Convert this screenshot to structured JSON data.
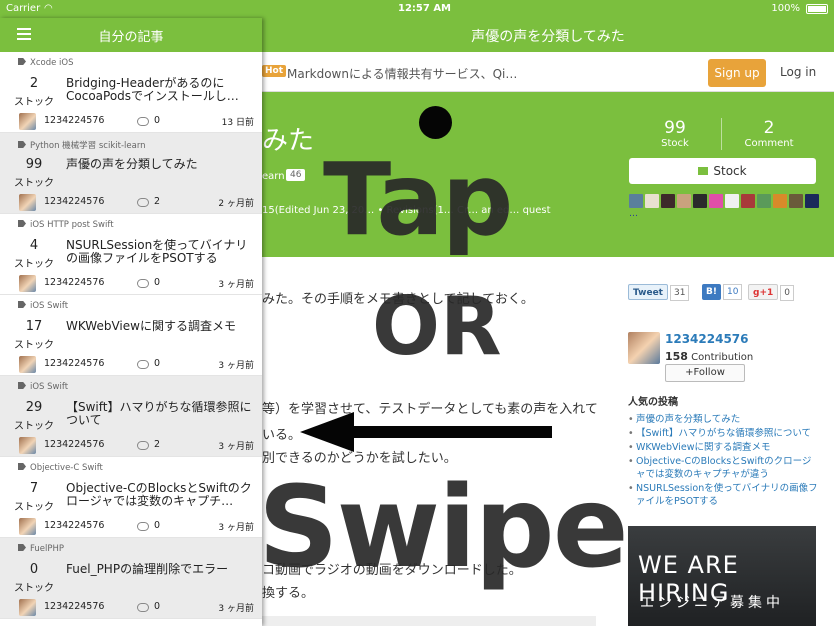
{
  "status_bar": {
    "carrier": "Carrier",
    "time": "12:57 AM",
    "battery": "100%"
  },
  "nav": {
    "title": "声優の声を分類してみた"
  },
  "site_header": {
    "hot_badge": "Hot",
    "hot_text": "Markdownによる情報共有サービス、Qi…",
    "signup": "Sign up",
    "login": "Log in"
  },
  "article": {
    "title_partial": "みた",
    "tag_partial": "earn",
    "tag_count": "46",
    "meta_partial": "15(Edited Jun 23, 20… • Revisions(1… Cr… an ed… quest",
    "stock_count": "99",
    "stock_label": "Stock",
    "comment_count": "2",
    "comment_label": "Comment",
    "stock_button": "Stock",
    "stockers_more": "…",
    "body_lines": [
      "みた。その手順をメモ書きとして記しておく。",
      "等）を学習させて、テストデータとしても素の声を入れて",
      "いる。",
      "別できるのかどうかを試したい。",
      "コ動画でラジオの動画をダウンロードした。",
      "換する。"
    ]
  },
  "sidebar": {
    "tweet_label": "Tweet",
    "tweet_count": "31",
    "hatena_label": "B!",
    "hatena_count": "10",
    "gplus_label": "g+1",
    "gplus_count": "0",
    "profile_name": "1234224576",
    "contribution_count": "158",
    "contribution_label": "Contribution",
    "follow_button": "+Follow",
    "popular_title": "人気の投稿",
    "popular_posts": [
      "声優の声を分類してみた",
      "【Swift】ハマりがちな循環参照について",
      "WKWebViewに関する調査メモ",
      "Objective-CのBlocksとSwiftのクロージャでは変数のキャプチャが違う",
      "NSURLSessionを使ってバイナリの画像ファイルをPSOTする"
    ],
    "hiring_line1": "WE ARE HIRING",
    "hiring_line2": "エンジニア募集中"
  },
  "drawer": {
    "title": "自分の記事",
    "stock_label": "ストック",
    "items": [
      {
        "tags": "Xcode iOS",
        "count": "2",
        "title": "Bridging-HeaderがあるのにCocoaPodsでインストールし…",
        "user": "1234224576",
        "comments": "0",
        "date": "13 日前"
      },
      {
        "tags": "Python 機械学習 scikit-learn",
        "count": "99",
        "title": "声優の声を分類してみた",
        "user": "1234224576",
        "comments": "2",
        "date": "2 ヶ月前"
      },
      {
        "tags": "iOS HTTP post Swift",
        "count": "4",
        "title": "NSURLSessionを使ってバイナリの画像ファイルをPSOTする",
        "user": "1234224576",
        "comments": "0",
        "date": "3 ヶ月前"
      },
      {
        "tags": "iOS Swift",
        "count": "17",
        "title": "WKWebViewに関する調査メモ",
        "user": "1234224576",
        "comments": "0",
        "date": "3 ヶ月前"
      },
      {
        "tags": "iOS Swift",
        "count": "29",
        "title": "【Swift】ハマりがちな循環参照について",
        "user": "1234224576",
        "comments": "2",
        "date": "3 ヶ月前"
      },
      {
        "tags": "Objective-C Swift",
        "count": "7",
        "title": "Objective-CのBlocksとSwiftのクロージャでは変数のキャプチ…",
        "user": "1234224576",
        "comments": "0",
        "date": "3 ヶ月前"
      },
      {
        "tags": "FuelPHP",
        "count": "0",
        "title": "Fuel_PHPの論理削除でエラー",
        "user": "1234224576",
        "comments": "0",
        "date": "3 ヶ月前"
      }
    ]
  },
  "overlay": {
    "tap": "Tap",
    "or": "OR",
    "swipe": "Swipe"
  },
  "colors": {
    "brand_green": "#7bbf3e",
    "signup_orange": "#e8a33a",
    "link_blue": "#2b7bb9"
  }
}
